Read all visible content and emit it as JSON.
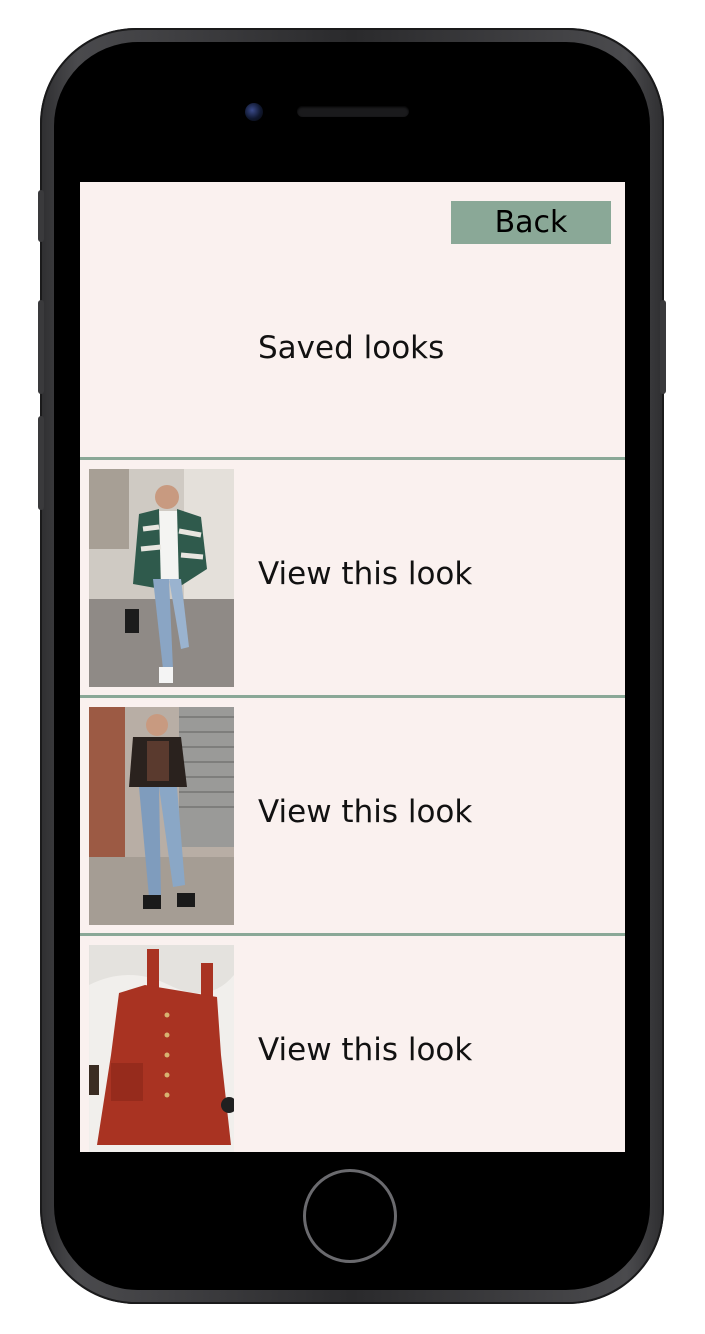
{
  "header": {
    "back_label": "Back",
    "title": "Saved looks"
  },
  "looks": [
    {
      "label": "View this look",
      "thumbnail": "plaid-shirt-jacket-jeans-outfit"
    },
    {
      "label": "View this look",
      "thumbnail": "leather-jacket-jeans-outfit"
    },
    {
      "label": "View this look",
      "thumbnail": "red-corduroy-overall-dress"
    }
  ],
  "colors": {
    "background": "#faf1ef",
    "accent": "#8aa897",
    "text": "#111111"
  }
}
